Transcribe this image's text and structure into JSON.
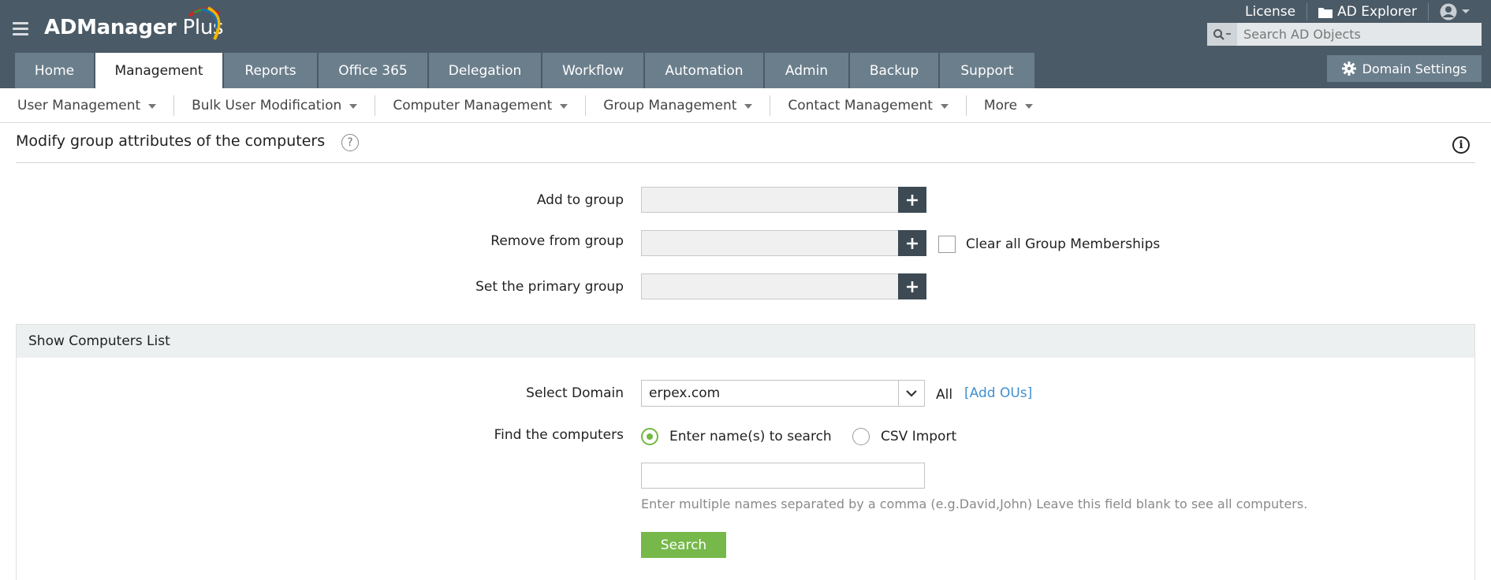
{
  "header": {
    "app_name_bold": "ADManager",
    "app_name_light": "Plus",
    "top_links": {
      "license": "License",
      "ad_explorer": "AD Explorer"
    },
    "search_placeholder": "Search AD Objects",
    "domain_settings": "Domain Settings",
    "icons": [
      "menu-icon",
      "folder-icon",
      "user-icon",
      "search-icon",
      "gear-icon"
    ]
  },
  "tabs": [
    {
      "label": "Home",
      "active": false
    },
    {
      "label": "Management",
      "active": true
    },
    {
      "label": "Reports",
      "active": false
    },
    {
      "label": "Office 365",
      "active": false
    },
    {
      "label": "Delegation",
      "active": false
    },
    {
      "label": "Workflow",
      "active": false
    },
    {
      "label": "Automation",
      "active": false
    },
    {
      "label": "Admin",
      "active": false
    },
    {
      "label": "Backup",
      "active": false
    },
    {
      "label": "Support",
      "active": false
    }
  ],
  "subnav": [
    {
      "label": "User Management"
    },
    {
      "label": "Bulk User Modification"
    },
    {
      "label": "Computer Management"
    },
    {
      "label": "Group Management"
    },
    {
      "label": "Contact Management"
    },
    {
      "label": "More"
    }
  ],
  "page": {
    "title": "Modify group attributes of the computers",
    "help_glyph": "?",
    "info_glyph": "i"
  },
  "form": {
    "add_to_group": "Add to group",
    "remove_from_group": "Remove from group",
    "set_primary_group": "Set the primary group",
    "clear_memberships": "Clear all Group Memberships"
  },
  "computers": {
    "section_title": "Show Computers List",
    "select_domain_label": "Select Domain",
    "domain_value": "erpex.com",
    "all_text": "All",
    "add_ous": "[Add OUs]",
    "find_label": "Find the computers",
    "option_names": "Enter name(s) to search",
    "option_csv": "CSV Import",
    "names_value": "",
    "hint": "Enter multiple names separated by a comma (e.g.David,John) Leave this field blank to see all computers.",
    "search_button": "Search"
  },
  "colors": {
    "header_bg": "#4a5a66",
    "tab_bg": "#6b7e8c",
    "accent_green": "#76b84a",
    "link_blue": "#3f8fd0"
  }
}
